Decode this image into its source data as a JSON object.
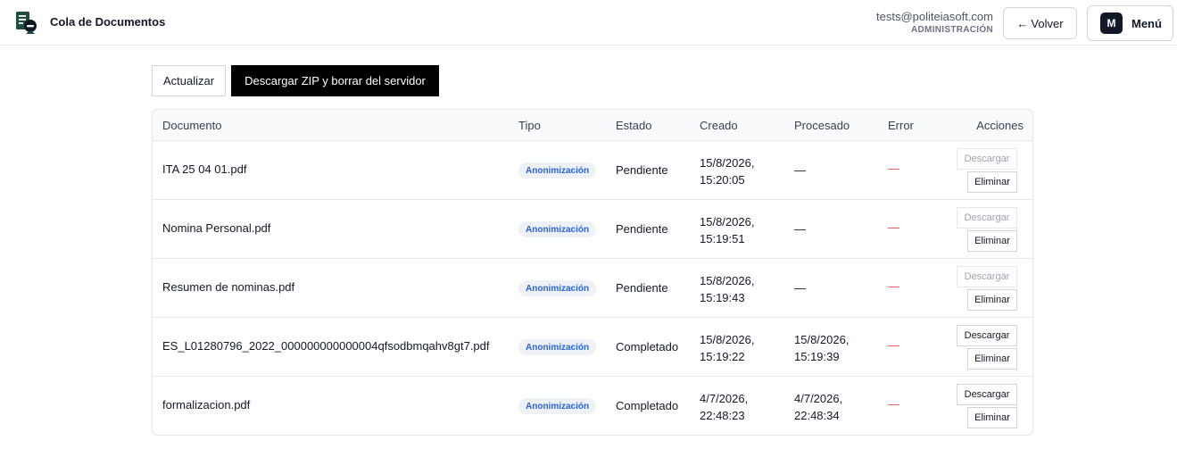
{
  "header": {
    "title": "Cola de Documentos",
    "logo_icon": "document-agent-icon",
    "user_email": "tests@politeiasoft.com",
    "user_role": "ADMINISTRACIÓN",
    "back_label": "Volver",
    "back_arrow": "←",
    "menu_avatar": "M",
    "menu_label": "Menú"
  },
  "toolbar": {
    "refresh_label": "Actualizar",
    "zip_label": "Descargar ZIP y borrar del servidor"
  },
  "table": {
    "columns": {
      "documento": "Documento",
      "tipo": "Tipo",
      "estado": "Estado",
      "creado": "Creado",
      "procesado": "Procesado",
      "error": "Error",
      "acciones": "Acciones"
    },
    "rows": [
      {
        "documento": "ITA 25 04 01.pdf",
        "tipo": "Anonimización",
        "estado": "Pendiente",
        "creado_date": "15/8/2026,",
        "creado_time": "15:20:05",
        "procesado_date": "—",
        "procesado_time": "",
        "error": "—",
        "download_label": "Descargar",
        "download_enabled": false,
        "delete_label": "Eliminar"
      },
      {
        "documento": "Nomina Personal.pdf",
        "tipo": "Anonimización",
        "estado": "Pendiente",
        "creado_date": "15/8/2026,",
        "creado_time": "15:19:51",
        "procesado_date": "—",
        "procesado_time": "",
        "error": "—",
        "download_label": "Descargar",
        "download_enabled": false,
        "delete_label": "Eliminar"
      },
      {
        "documento": "Resumen de nominas.pdf",
        "tipo": "Anonimización",
        "estado": "Pendiente",
        "creado_date": "15/8/2026,",
        "creado_time": "15:19:43",
        "procesado_date": "—",
        "procesado_time": "",
        "error": "—",
        "download_label": "Descargar",
        "download_enabled": false,
        "delete_label": "Eliminar"
      },
      {
        "documento": "ES_L01280796_2022_000000000000004qfsodbmqahv8gt7.pdf",
        "tipo": "Anonimización",
        "estado": "Completado",
        "creado_date": "15/8/2026,",
        "creado_time": "15:19:22",
        "procesado_date": "15/8/2026,",
        "procesado_time": "15:19:39",
        "error": "—",
        "download_label": "Descargar",
        "download_enabled": true,
        "delete_label": "Eliminar"
      },
      {
        "documento": "formalizacion.pdf",
        "tipo": "Anonimización",
        "estado": "Completado",
        "creado_date": "4/7/2026,",
        "creado_time": "22:48:23",
        "procesado_date": "4/7/2026,",
        "procesado_time": "22:48:34",
        "error": "—",
        "download_label": "Descargar",
        "download_enabled": true,
        "delete_label": "Eliminar"
      }
    ]
  },
  "colors": {
    "badge_text": "#2563eb",
    "badge_bg": "#eef2f7",
    "error_dash": "#ef4444",
    "primary_button": "#000000"
  }
}
